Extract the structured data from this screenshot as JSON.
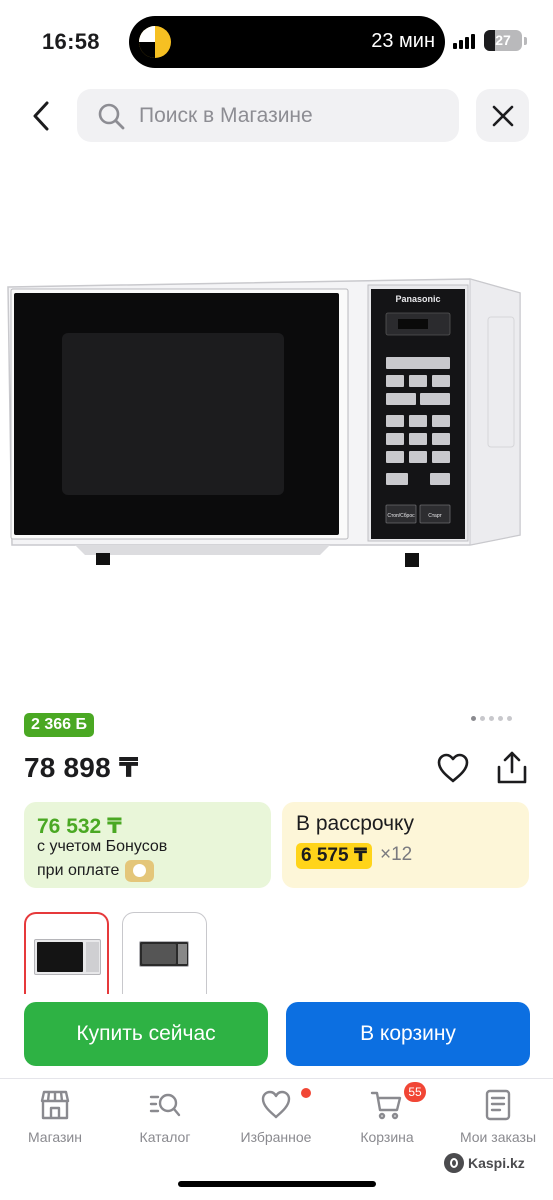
{
  "status_bar": {
    "time": "16:58",
    "island_text": "23 мин",
    "battery": "27",
    "battery_level": 0.27
  },
  "search": {
    "placeholder": "Поиск в Магазине",
    "back_icon": "chevron-left-icon",
    "search_icon": "magnifier-icon",
    "close_icon": "close-icon"
  },
  "product": {
    "bonus_badge": "2 366 Б",
    "price": "78 898 ₸",
    "gallery_total": 5,
    "gallery_active": 1
  },
  "bonus_card": {
    "price": "76 532 ₸",
    "line1": "с учетом Бонусов",
    "line2": "при оплате"
  },
  "installment_card": {
    "title": "В рассрочку",
    "monthly": "6 575 ₸",
    "multiplier": "×12"
  },
  "actions": {
    "buy_now": "Купить сейчас",
    "add_to_cart": "В корзину"
  },
  "nav": {
    "items": [
      {
        "label": "Магазин",
        "icon": "shop-icon"
      },
      {
        "label": "Каталог",
        "icon": "catalog-search-icon"
      },
      {
        "label": "Избранное",
        "icon": "heart-icon"
      },
      {
        "label": "Корзина",
        "icon": "cart-icon"
      },
      {
        "label": "Мои заказы",
        "icon": "orders-icon"
      }
    ],
    "cart_count": "55"
  },
  "watermark": "Kaspi.kz",
  "colors": {
    "green": "#2eb244",
    "blue": "#0c6fe1",
    "bonus_green": "#4aa823",
    "installment_yellow": "#ffd41a",
    "badge_red": "#f14635"
  },
  "product_image": {
    "brand": "Panasonic",
    "buttons": [
      "Стоп/Сброс",
      "Старт"
    ]
  }
}
